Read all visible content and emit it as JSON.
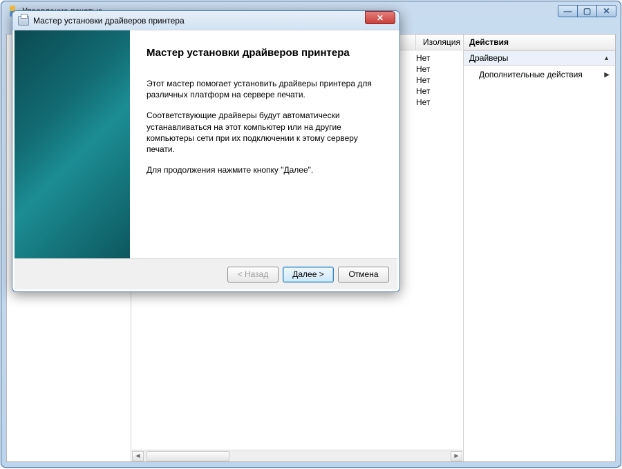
{
  "mgmt": {
    "title": "Управление печатью",
    "caption_buttons": {
      "min": "—",
      "max": "▢",
      "close": "✕"
    },
    "list": {
      "column_label": "Изоляция драй",
      "rows": [
        "Нет",
        "Нет",
        "Нет",
        "Нет",
        "Нет"
      ]
    },
    "actions": {
      "header": "Действия",
      "section": "Драйверы",
      "item": "Дополнительные действия"
    }
  },
  "wizard": {
    "title": "Мастер установки драйверов принтера",
    "heading": "Мастер установки драйверов принтера",
    "p1": "Этот мастер помогает установить драйверы принтера для различных платформ на сервере печати.",
    "p2": "Соответствующие драйверы будут автоматически устанавливаться на этот компьютер или на другие компьютеры сети при их подключении к этому серверу печати.",
    "p3": "Для продолжения нажмите кнопку \"Далее\".",
    "buttons": {
      "back": "< Назад",
      "next": "Далее >",
      "cancel": "Отмена"
    }
  }
}
